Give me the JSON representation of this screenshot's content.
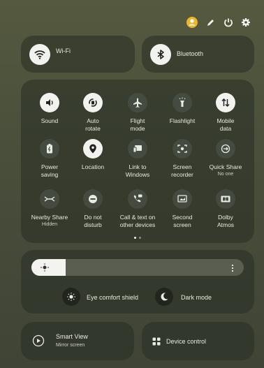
{
  "header": {
    "icons": [
      "user-avatar-icon",
      "pencil-edit-icon",
      "power-icon",
      "settings-gear-icon"
    ],
    "avatar_color": "#e9b62c"
  },
  "wifi": {
    "label": "Wi-Fi",
    "state": "on"
  },
  "bluetooth": {
    "label": "Bluetooth",
    "state": "on"
  },
  "quick_settings": [
    {
      "label": "Sound",
      "sub": "",
      "icon": "speaker-icon",
      "on": true
    },
    {
      "label": "Auto\nrotate",
      "sub": "",
      "icon": "auto-rotate-icon",
      "on": true
    },
    {
      "label": "Flight\nmode",
      "sub": "",
      "icon": "airplane-icon",
      "on": false
    },
    {
      "label": "Flashlight",
      "sub": "",
      "icon": "flashlight-icon",
      "on": false
    },
    {
      "label": "Mobile\ndata",
      "sub": "",
      "icon": "mobile-data-icon",
      "on": true
    },
    {
      "label": "Power\nsaving",
      "sub": "",
      "icon": "battery-icon",
      "on": false
    },
    {
      "label": "Location",
      "sub": "",
      "icon": "location-pin-icon",
      "on": true
    },
    {
      "label": "Link to\nWindows",
      "sub": "",
      "icon": "link-to-windows-icon",
      "on": false
    },
    {
      "label": "Screen\nrecorder",
      "sub": "",
      "icon": "screen-recorder-icon",
      "on": false
    },
    {
      "label": "Quick Share",
      "sub": "No one",
      "icon": "quick-share-icon",
      "on": false
    },
    {
      "label": "Nearby Share",
      "sub": "Hidden",
      "icon": "nearby-share-icon",
      "on": false
    },
    {
      "label": "Do not\ndisturb",
      "sub": "",
      "icon": "do-not-disturb-icon",
      "on": false
    },
    {
      "label": "Call & text on\nother devices",
      "sub": "",
      "icon": "call-text-icon",
      "on": false
    },
    {
      "label": "Second\nscreen",
      "sub": "",
      "icon": "second-screen-icon",
      "on": false
    },
    {
      "label": "Dolby\nAtmos",
      "sub": "",
      "icon": "dolby-icon",
      "on": false
    }
  ],
  "page_indicator": {
    "pages": 2,
    "current": 1
  },
  "brightness": {
    "level": 0.16
  },
  "eye_comfort": {
    "label": "Eye comfort shield"
  },
  "dark_mode": {
    "label": "Dark mode"
  },
  "smart_view": {
    "label": "Smart View",
    "sub": "Mirror screen"
  },
  "device_control": {
    "label": "Device control"
  },
  "colors": {
    "tile_on": "#f2f2ee",
    "tile_off": "#464c42",
    "accent_avatar": "#e9b62c"
  }
}
